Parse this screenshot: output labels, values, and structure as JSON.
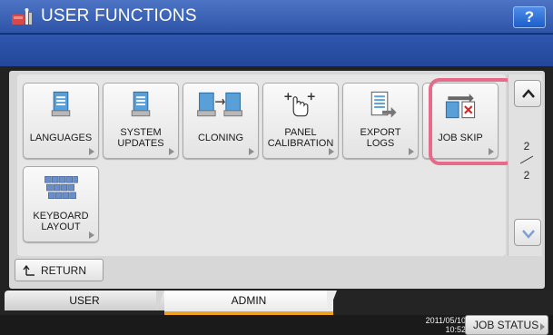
{
  "header": {
    "title": "USER FUNCTIONS",
    "help_label": "?",
    "logo_icon": "toolbox-icon"
  },
  "functions": [
    {
      "label": "LANGUAGES",
      "icon": "languages-icon"
    },
    {
      "label": "SYSTEM\nUPDATES",
      "icon": "system-updates-icon"
    },
    {
      "label": "CLONING",
      "icon": "cloning-icon"
    },
    {
      "label": "PANEL\nCALIBRATION",
      "icon": "panel-calibration-icon"
    },
    {
      "label": "EXPORT\nLOGS",
      "icon": "export-logs-icon"
    },
    {
      "label": "JOB SKIP",
      "icon": "job-skip-icon",
      "highlighted": true
    },
    {
      "label": "KEYBOARD\nLAYOUT",
      "icon": "keyboard-icon"
    }
  ],
  "pager": {
    "current": "2",
    "total": "2"
  },
  "return_label": "RETURN",
  "tabs": [
    {
      "label": "USER",
      "active": false
    },
    {
      "label": "ADMIN",
      "active": true
    }
  ],
  "status_bar": {
    "date": "2011/05/10",
    "time": "10:52",
    "job_status_label": "JOB STATUS"
  },
  "colors": {
    "header_blue": "#2d54a8",
    "highlight_pink": "#e66a8a",
    "active_tab_underline": "#f0a020"
  }
}
